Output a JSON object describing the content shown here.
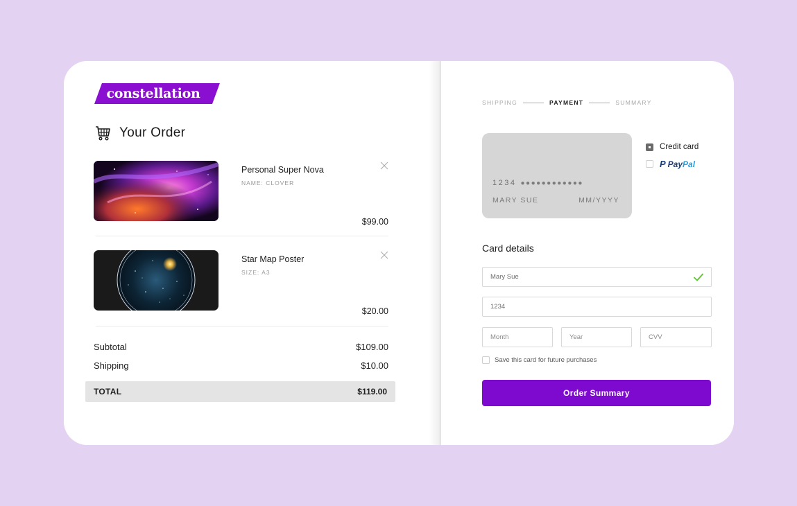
{
  "brand": {
    "name": "constellation",
    "color": "#8a0fd0"
  },
  "order": {
    "title": "Your Order",
    "items": [
      {
        "name": "Personal Super Nova",
        "detail": "NAME: CLOVER",
        "price": "$99.00"
      },
      {
        "name": "Star Map Poster",
        "detail": "SIZE: A3",
        "price": "$20.00"
      }
    ],
    "summary": {
      "subtotal_label": "Subtotal",
      "subtotal": "$109.00",
      "shipping_label": "Shipping",
      "shipping": "$10.00",
      "total_label": "TOTAL",
      "total": "$119.00"
    }
  },
  "checkout": {
    "steps": [
      "SHIPPING",
      "PAYMENT",
      "SUMMARY"
    ],
    "active_step": "PAYMENT",
    "card_preview": {
      "number_prefix": "1234",
      "number_mask": "●●●●●●●●●●●●",
      "holder": "MARY SUE",
      "expiry": "MM/YYYY"
    },
    "methods": {
      "credit_card": "Credit card",
      "paypal_a": "Pay",
      "paypal_b": "Pal",
      "paypal_mark": "P"
    },
    "card_details_title": "Card details",
    "fields": {
      "name_value": "Mary Sue",
      "number_value": "1234",
      "month_placeholder": "Month",
      "year_placeholder": "Year",
      "cvv_placeholder": "CVV"
    },
    "save_label": "Save this card for future purchases",
    "button_label": "Order Summary",
    "button_color": "#7e0ad0",
    "success_color": "#5cc62a"
  }
}
